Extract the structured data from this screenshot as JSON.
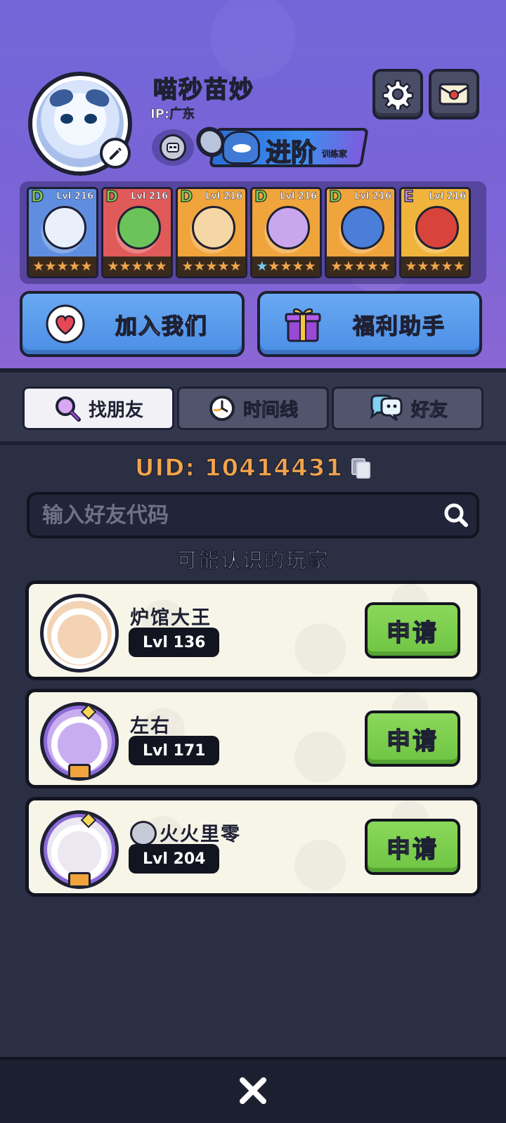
{
  "profile": {
    "name": "喵秒苗妙",
    "ip": "IP:广东",
    "advance_label": "进阶",
    "advance_sub": "训练家"
  },
  "pets": [
    {
      "grade": "D",
      "level": "Lvl 216",
      "stars": [
        "orange",
        "orange",
        "orange",
        "orange",
        "orange"
      ],
      "bg": "#5f8ee0",
      "creature": "#e9f0fb",
      "grade_color": "#7cd04a"
    },
    {
      "grade": "D",
      "level": "Lvl 216",
      "stars": [
        "orange",
        "orange",
        "orange",
        "orange",
        "orange"
      ],
      "bg": "#e05a5a",
      "creature": "#6cc35a",
      "grade_color": "#7cd04a"
    },
    {
      "grade": "D",
      "level": "Lvl 216",
      "stars": [
        "orange",
        "orange",
        "orange",
        "orange",
        "orange"
      ],
      "bg": "#f0a43c",
      "creature": "#f5d7a5",
      "grade_color": "#7cd04a"
    },
    {
      "grade": "D",
      "level": "Lvl 216",
      "stars": [
        "blue",
        "orange",
        "orange",
        "orange",
        "orange"
      ],
      "bg": "#f0a43c",
      "creature": "#c9a6ee",
      "grade_color": "#7cd04a"
    },
    {
      "grade": "D",
      "level": "Lvl 216",
      "stars": [
        "orange",
        "orange",
        "orange",
        "orange",
        "orange"
      ],
      "bg": "#f0a43c",
      "creature": "#4a7ed8",
      "grade_color": "#7cd04a"
    },
    {
      "grade": "E",
      "level": "Lvl 216",
      "stars": [
        "orange",
        "orange",
        "orange",
        "orange",
        "orange"
      ],
      "bg": "#f0b43c",
      "creature": "#d8443c",
      "grade_color": "#b78be8"
    }
  ],
  "actions": {
    "join_label": "加入我们",
    "welfare_label": "福利助手"
  },
  "tabs": [
    {
      "label": "找朋友",
      "icon": "magnifier-icon",
      "active": true
    },
    {
      "label": "时间线",
      "icon": "clock-icon",
      "active": false
    },
    {
      "label": "好友",
      "icon": "chat-bubble-icon",
      "active": false
    }
  ],
  "uid": "UID:  10414431",
  "search": {
    "placeholder": "输入好友代码"
  },
  "suggestions_title": "可能认识的玩家",
  "players": [
    {
      "name": "炉馆大王",
      "level": "Lvl 136",
      "apply_label": "申请",
      "ring": "#ffffff",
      "face": "#f3d3b3",
      "has_badge": false
    },
    {
      "name": "左右",
      "level": "Lvl 171",
      "apply_label": "申请",
      "ring": "#8c6ad8",
      "face": "#c8aef0",
      "has_badge": false
    },
    {
      "name": "火火里零",
      "level": "Lvl 204",
      "apply_label": "申请",
      "ring": "#8c6ad8",
      "face": "#ece8f2",
      "has_badge": true
    }
  ],
  "colors": {
    "header_purple": "#7466d9",
    "uid_orange": "#f2a44b",
    "apply_green": "#78c94b",
    "action_blue": "#5a9bec"
  }
}
